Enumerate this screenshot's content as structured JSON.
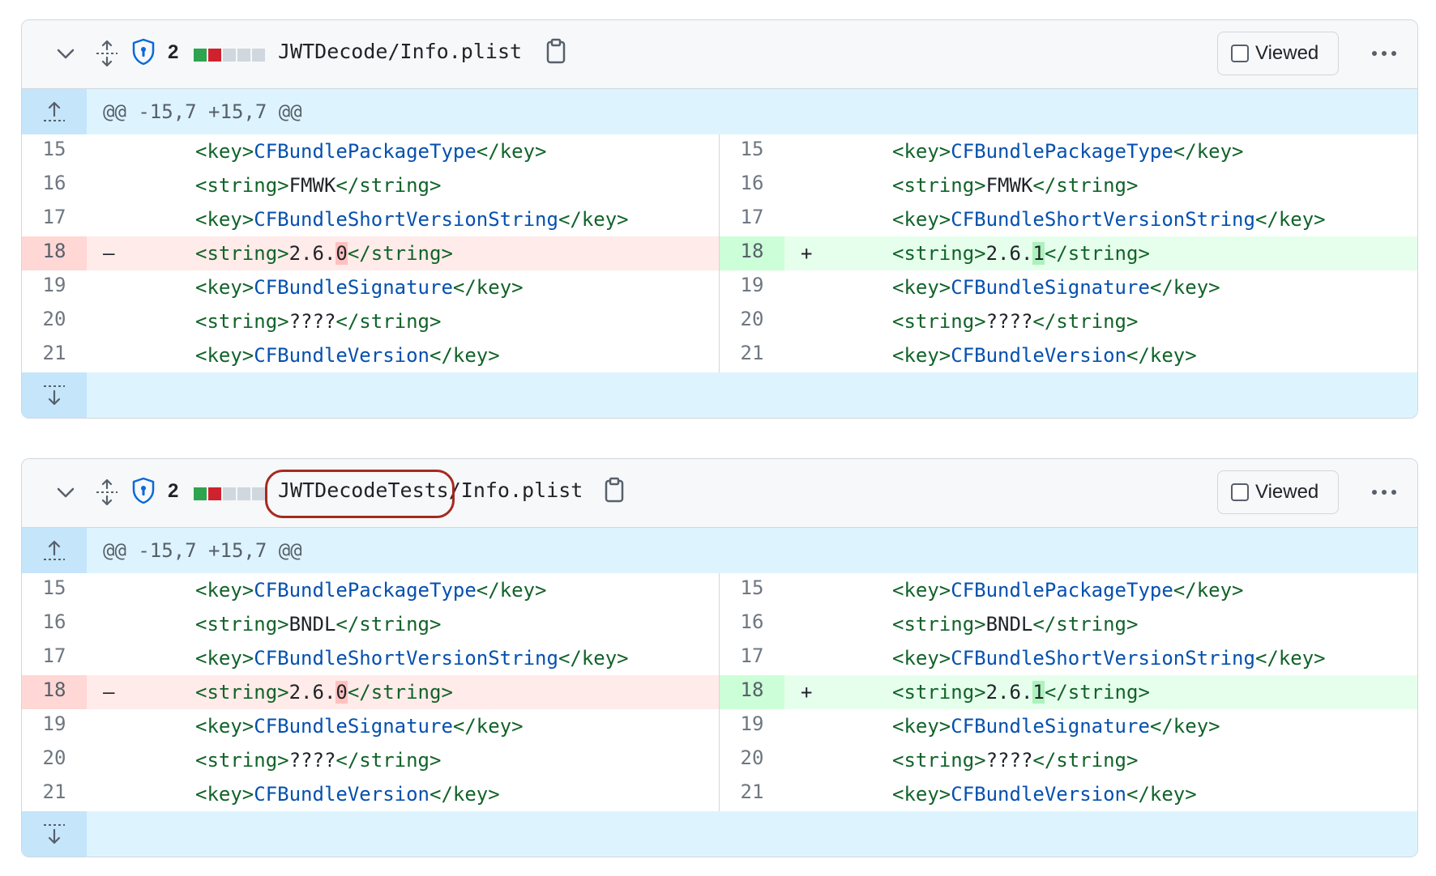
{
  "files": [
    {
      "additions": 1,
      "deletions": 1,
      "changes": "2",
      "stat_colors": [
        "#2da44e",
        "#cf222e",
        "#d0d7de",
        "#d0d7de",
        "#d0d7de"
      ],
      "dir": "JWTDecode",
      "sep": "/",
      "name": "Info.plist",
      "viewed_label": "Viewed",
      "hunk_header": "@@ -15,7 +15,7 @@",
      "lines": [
        {
          "old_ln": "15",
          "new_ln": "15",
          "tag": "key",
          "value": "CFBundlePackageType"
        },
        {
          "old_ln": "16",
          "new_ln": "16",
          "tag": "string",
          "value": "FMWK"
        },
        {
          "old_ln": "17",
          "new_ln": "17",
          "tag": "key",
          "value": "CFBundleShortVersionString"
        },
        {
          "old_ln": "18",
          "new_ln": "18",
          "changed": true,
          "del_mark": "–",
          "add_mark": "+",
          "tag": "string",
          "old_prefix": "2.6.",
          "old_hl": "0",
          "new_prefix": "2.6.",
          "new_hl": "1"
        },
        {
          "old_ln": "19",
          "new_ln": "19",
          "tag": "key",
          "value": "CFBundleSignature"
        },
        {
          "old_ln": "20",
          "new_ln": "20",
          "tag": "string",
          "value": "????"
        },
        {
          "old_ln": "21",
          "new_ln": "21",
          "tag": "key",
          "value": "CFBundleVersion"
        }
      ]
    },
    {
      "additions": 1,
      "deletions": 1,
      "changes": "2",
      "stat_colors": [
        "#2da44e",
        "#cf222e",
        "#d0d7de",
        "#d0d7de",
        "#d0d7de"
      ],
      "dir": "JWTDecodeTests",
      "sep": "/",
      "name": "Info.plist",
      "viewed_label": "Viewed",
      "hunk_header": "@@ -15,7 +15,7 @@",
      "lines": [
        {
          "old_ln": "15",
          "new_ln": "15",
          "tag": "key",
          "value": "CFBundlePackageType"
        },
        {
          "old_ln": "16",
          "new_ln": "16",
          "tag": "string",
          "value": "BNDL"
        },
        {
          "old_ln": "17",
          "new_ln": "17",
          "tag": "key",
          "value": "CFBundleShortVersionString"
        },
        {
          "old_ln": "18",
          "new_ln": "18",
          "changed": true,
          "del_mark": "–",
          "add_mark": "+",
          "tag": "string",
          "old_prefix": "2.6.",
          "old_hl": "0",
          "new_prefix": "2.6.",
          "new_hl": "1"
        },
        {
          "old_ln": "19",
          "new_ln": "19",
          "tag": "key",
          "value": "CFBundleSignature"
        },
        {
          "old_ln": "20",
          "new_ln": "20",
          "tag": "string",
          "value": "????"
        },
        {
          "old_ln": "21",
          "new_ln": "21",
          "tag": "key",
          "value": "CFBundleVersion"
        }
      ]
    }
  ],
  "icons": {
    "collapse": "chevron-down-icon",
    "expand_all": "unfold-icon",
    "security": "shield-lock-icon",
    "copy": "copy-icon",
    "more": "kebab-horizontal-icon",
    "expand_up": "fold-up-icon",
    "expand_down": "fold-down-icon"
  },
  "annotation_color": "#a52a1f"
}
